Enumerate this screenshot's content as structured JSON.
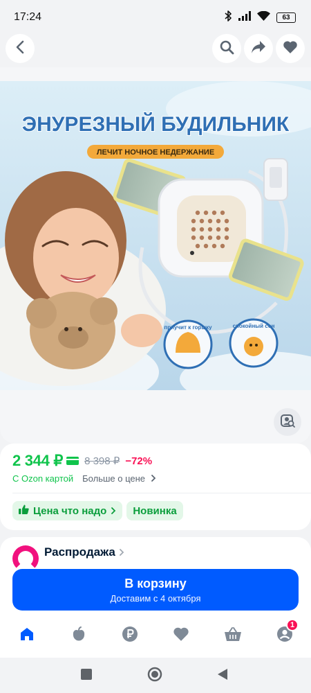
{
  "status_bar": {
    "time": "17:24",
    "battery": "63",
    "icons": [
      "bluetooth-icon",
      "signal-icon",
      "wifi-icon",
      "battery-icon"
    ]
  },
  "top_bar": {
    "icons": [
      "back-arrow-icon",
      "search-icon",
      "share-icon",
      "heart-icon"
    ]
  },
  "product": {
    "image_alt": "ЭНУРЕЗНЫЙ БУДИЛЬНИК — ЛЕЧИТ НОЧНОЕ НЕДЕРЖАНИЕ",
    "image_text": {
      "title": "ЭНУРЕЗНЫЙ БУДИЛЬНИК",
      "subtitle": "ЛЕЧИТ НОЧНОЕ НЕДЕРЖАНИЕ",
      "badge_1": "приучит к горшку",
      "badge_2": "спокойный сон"
    },
    "similar_search_icon": "image-search-icon"
  },
  "price": {
    "current": "2 344 ₽",
    "old": "8 398 ₽",
    "discount": "−72%",
    "ozon_card_label": "С Ozon картой",
    "more_label": "Больше о цене",
    "colors": {
      "accent_green": "#10c44c",
      "discount_red": "#f91155"
    }
  },
  "tags": [
    {
      "label": "Цена что надо",
      "icon": "thumbs-up-icon"
    },
    {
      "label": "Новинка"
    }
  ],
  "seller": {
    "name": "Распродажа"
  },
  "cart_button": {
    "label": "В корзину",
    "sub": "Доставим с 4 октября",
    "color": "#005bff"
  },
  "bottom_nav": {
    "items": [
      {
        "name": "home",
        "icon": "home-icon"
      },
      {
        "name": "fresh",
        "icon": "apple-icon"
      },
      {
        "name": "finance",
        "icon": "ruble-icon"
      },
      {
        "name": "favorites",
        "icon": "heart-icon"
      },
      {
        "name": "cart",
        "icon": "basket-icon"
      },
      {
        "name": "profile",
        "icon": "profile-icon",
        "badge": "1"
      }
    ]
  },
  "system_nav": {
    "icons": [
      "recents-square-icon",
      "home-circle-icon",
      "back-triangle-icon"
    ]
  }
}
